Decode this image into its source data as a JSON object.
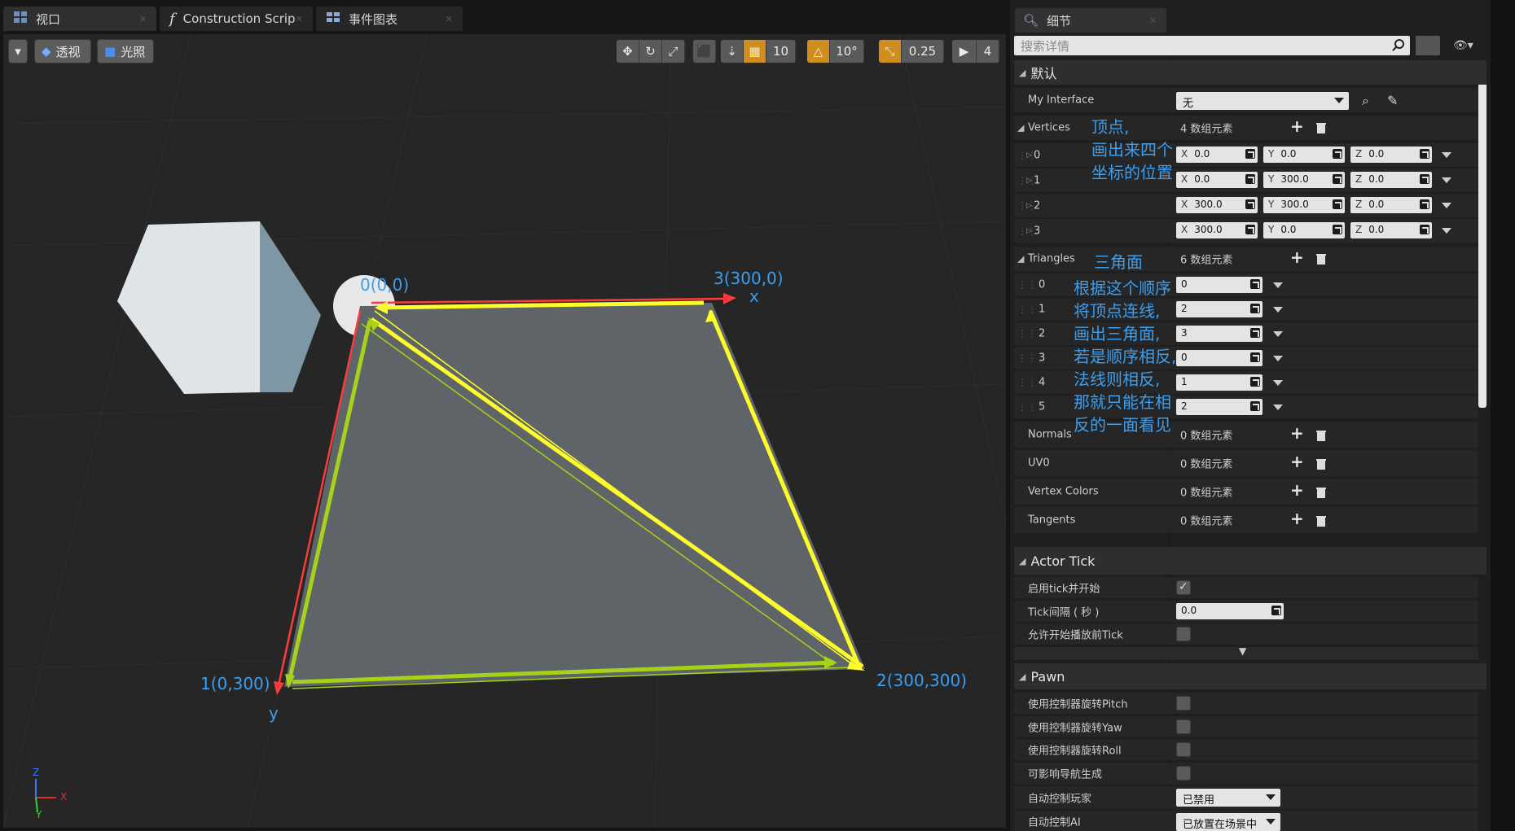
{
  "tabs": [
    {
      "label": "视口",
      "icon": "viewport-icon"
    },
    {
      "label": "Construction Scrip",
      "icon": "function-icon"
    },
    {
      "label": "事件图表",
      "icon": "event-graph-icon"
    }
  ],
  "viewport": {
    "menu_icon": "dropdown-menu-icon",
    "perspective_label": "透视",
    "lit_label": "光照",
    "toolbar": {
      "grid_snap": "10",
      "rotation_snap": "10°",
      "scale_snap": "0.25",
      "camera_speed": "4"
    },
    "labels": {
      "v0": "0(0,0)",
      "v1": "1(0,300)",
      "v2": "2(300,300)",
      "v3": "3(300,0)",
      "x_axis": "x",
      "y_axis": "y"
    },
    "axis_gizmo": {
      "x": "X",
      "y": "Y",
      "z": "Z"
    }
  },
  "details": {
    "tab_label": "细节",
    "search_placeholder": "搜索详情",
    "section_default": "默认",
    "my_interface": {
      "label": "My Interface",
      "value": "无"
    },
    "vertices": {
      "label": "Vertices",
      "count": "4 数组元素",
      "items": [
        {
          "index": "0",
          "x": "0.0",
          "y": "0.0",
          "z": "0.0"
        },
        {
          "index": "1",
          "x": "0.0",
          "y": "300.0",
          "z": "0.0"
        },
        {
          "index": "2",
          "x": "300.0",
          "y": "300.0",
          "z": "0.0"
        },
        {
          "index": "3",
          "x": "300.0",
          "y": "0.0",
          "z": "0.0"
        }
      ]
    },
    "vertices_annotation": [
      "顶点,",
      "画出来四个",
      "坐标的位置"
    ],
    "triangles": {
      "label": "Triangles",
      "count": "6 数组元素",
      "items": [
        {
          "index": "0",
          "value": "0"
        },
        {
          "index": "1",
          "value": "2"
        },
        {
          "index": "2",
          "value": "3"
        },
        {
          "index": "3",
          "value": "0"
        },
        {
          "index": "4",
          "value": "1"
        },
        {
          "index": "5",
          "value": "2"
        }
      ]
    },
    "triangles_annotation_title": "三角面",
    "triangles_annotation": [
      "根据这个顺序",
      "将顶点连线,",
      "画出三角面,",
      "若是顺序相反,",
      "法线则相反,",
      "那就只能在相",
      "反的一面看见"
    ],
    "arrays": [
      {
        "label": "Normals",
        "count": "0 数组元素"
      },
      {
        "label": "UV0",
        "count": "0 数组元素"
      },
      {
        "label": "Vertex Colors",
        "count": "0 数组元素"
      },
      {
        "label": "Tangents",
        "count": "0 数组元素"
      }
    ],
    "section_actor_tick": "Actor Tick",
    "actor_tick": {
      "start_with_tick": "启用tick并开始",
      "tick_interval_label": "Tick间隔 ( 秒 )",
      "tick_interval_value": "0.0",
      "allow_before_play": "允许开始播放前Tick"
    },
    "section_pawn": "Pawn",
    "pawn": {
      "pitch": "使用控制器旋转Pitch",
      "yaw": "使用控制器旋转Yaw",
      "roll": "使用控制器旋转Roll",
      "nav": "可影响导航生成",
      "auto_possess_player": {
        "label": "自动控制玩家",
        "value": "已禁用"
      },
      "auto_possess_ai": {
        "label": "自动控制AI",
        "value": "已放置在场景中"
      }
    }
  }
}
